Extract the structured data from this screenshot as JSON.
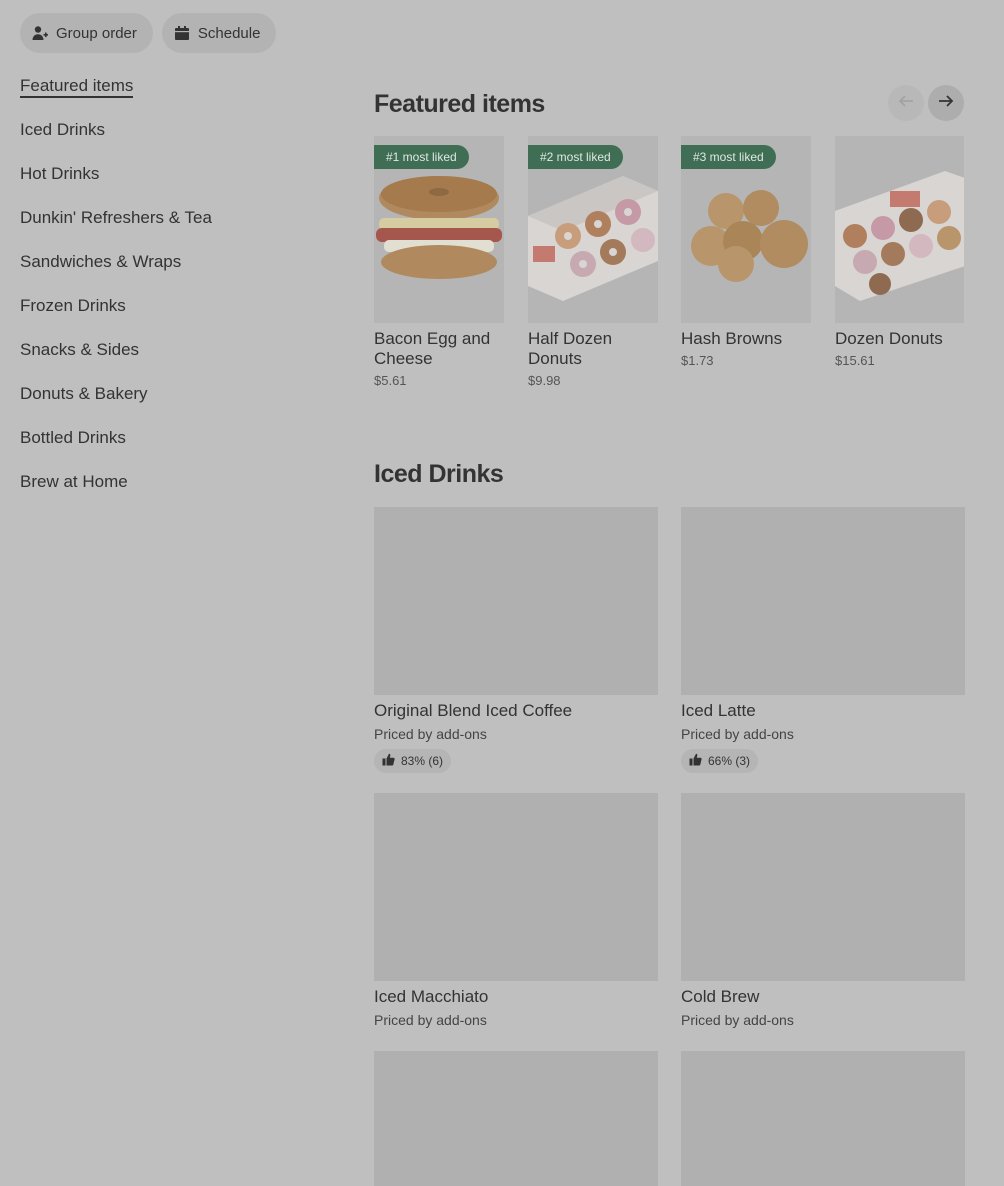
{
  "top_actions": {
    "group_order": "Group order",
    "schedule": "Schedule"
  },
  "sidebar": {
    "items": [
      {
        "label": "Featured items"
      },
      {
        "label": "Iced Drinks"
      },
      {
        "label": "Hot Drinks"
      },
      {
        "label": "Dunkin' Refreshers & Tea"
      },
      {
        "label": "Sandwiches & Wraps"
      },
      {
        "label": "Frozen Drinks"
      },
      {
        "label": "Snacks & Sides"
      },
      {
        "label": "Donuts & Bakery"
      },
      {
        "label": "Bottled Drinks"
      },
      {
        "label": "Brew at Home"
      }
    ]
  },
  "featured": {
    "title": "Featured items",
    "items": [
      {
        "badge": "#1 most liked",
        "name": "Bacon Egg and Cheese",
        "price": "$5.61",
        "image": "sandwich-image"
      },
      {
        "badge": "#2 most liked",
        "name": "Half Dozen Donuts",
        "price": "$9.98",
        "image": "donut-box-image"
      },
      {
        "badge": "#3 most liked",
        "name": "Hash Browns",
        "price": "$1.73",
        "image": "hash-browns-image"
      },
      {
        "badge": "",
        "name": "Dozen Donuts",
        "price": "$15.61",
        "image": "donut-box-image"
      }
    ]
  },
  "iced_drinks": {
    "title": "Iced Drinks",
    "items": [
      {
        "name": "Original Blend Iced Coffee",
        "sub": "Priced by add-ons",
        "rating": "83% (6)"
      },
      {
        "name": "Iced Latte",
        "sub": "Priced by add-ons",
        "rating": "66% (3)"
      },
      {
        "name": "Iced Macchiato",
        "sub": "Priced by add-ons",
        "rating": ""
      },
      {
        "name": "Cold Brew",
        "sub": "Priced by add-ons",
        "rating": ""
      },
      {
        "name": "",
        "sub": "",
        "rating": ""
      },
      {
        "name": "",
        "sub": "",
        "rating": ""
      }
    ]
  },
  "colors": {
    "overlay_bg": "#bfbfbf",
    "badge_green": "#3f6e55"
  }
}
